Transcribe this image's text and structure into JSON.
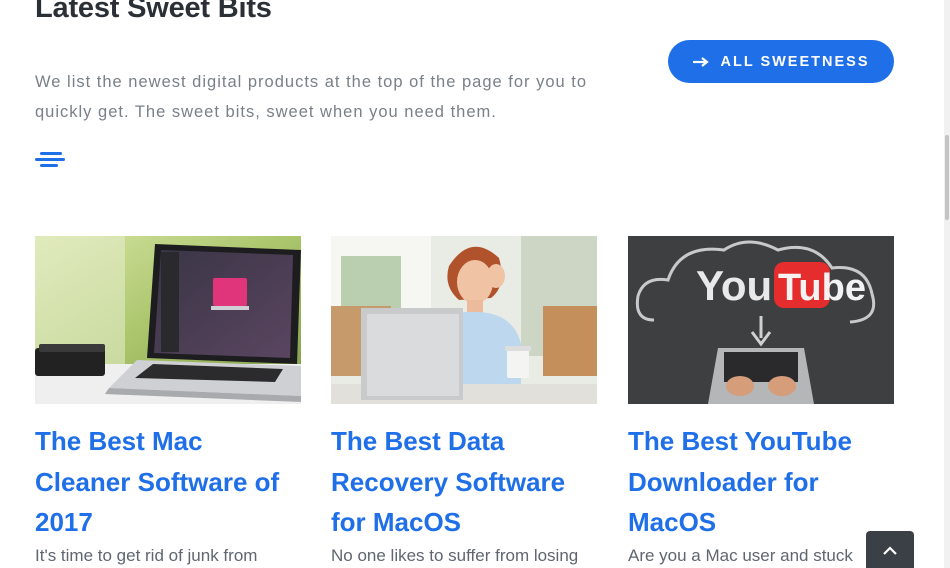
{
  "section": {
    "title": "Latest Sweet Bits",
    "intro": "We list the newest digital products at the top of the page for you to quickly get. The sweet bits, sweet when you need them.",
    "cta_label": "ALL SWEETNESS",
    "accent_color": "#1f6fe8"
  },
  "posts": [
    {
      "title": "The Best Mac Cleaner Software of 2017",
      "excerpt": "It's time to get rid of junk from",
      "image_icon": "laptop-photo"
    },
    {
      "title": "The Best Data Recovery Software for MacOS",
      "excerpt": "No one likes to suffer from losing",
      "image_icon": "frustrated-woman-laptop-photo"
    },
    {
      "title": "The Best YouTube Downloader for MacOS",
      "excerpt": "Are you a Mac user and stuck",
      "image_icon": "youtube-download-photo",
      "image_text_you": "You",
      "image_text_tube": "Tube"
    }
  ],
  "scroll_top_icon": "chevron-up-icon"
}
